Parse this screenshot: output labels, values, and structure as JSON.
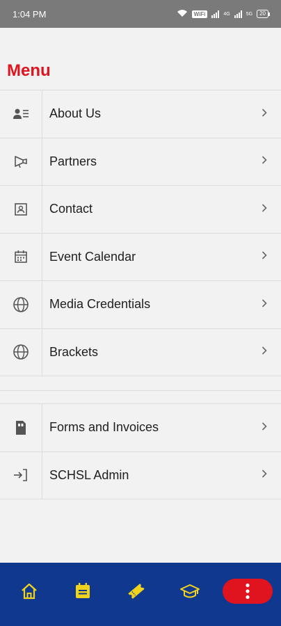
{
  "status_bar": {
    "time": "1:04 PM",
    "wifi_badge": "WiFi",
    "signal_label_1": "4G",
    "signal_label_2": "5G",
    "battery": "20"
  },
  "menu": {
    "title": "Menu",
    "items": [
      {
        "label": "About Us",
        "icon": "person-list-icon"
      },
      {
        "label": "Partners",
        "icon": "megaphone-icon"
      },
      {
        "label": "Contact",
        "icon": "contact-card-icon"
      },
      {
        "label": "Event Calendar",
        "icon": "calendar-icon"
      },
      {
        "label": "Media Credentials",
        "icon": "globe-icon"
      },
      {
        "label": "Brackets",
        "icon": "globe-icon"
      }
    ],
    "secondary_items": [
      {
        "label": "Forms and Invoices",
        "icon": "document-icon"
      },
      {
        "label": "SCHSL Admin",
        "icon": "login-icon"
      }
    ]
  },
  "bottom_nav": {
    "items": [
      "home-icon",
      "news-icon",
      "ticket-icon",
      "graduation-cap-icon",
      "more-vertical-icon"
    ]
  },
  "colors": {
    "accent_red": "#e0141e",
    "nav_blue": "#10388f",
    "nav_icon_yellow": "#f2d31b"
  }
}
